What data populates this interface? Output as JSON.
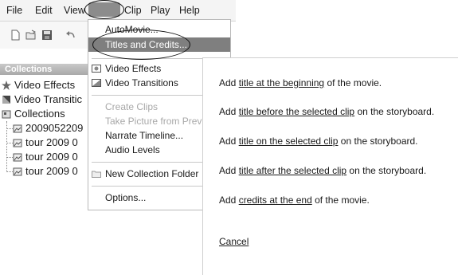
{
  "menubar": {
    "file": "File",
    "edit": "Edit",
    "view": "View",
    "clip": "Clip",
    "play": "Play",
    "help": "Help"
  },
  "sidebar": {
    "header": "Collections",
    "items": [
      {
        "label": "Video Effects",
        "icon": "star-icon"
      },
      {
        "label": "Video Transitic",
        "icon": "transition-icon"
      },
      {
        "label": "Collections",
        "icon": "collections-icon"
      },
      {
        "label": "2009052209",
        "icon": "collection-folder-icon"
      },
      {
        "label": "tour 2009 0",
        "icon": "collection-folder-icon"
      },
      {
        "label": "tour 2009 0",
        "icon": "collection-folder-icon"
      },
      {
        "label": "tour 2009 0",
        "icon": "collection-folder-icon"
      }
    ]
  },
  "tools_menu": {
    "automovie": "AutoMovie...",
    "titles_credits": "Titles and Credits...",
    "video_effects": "Video Effects",
    "video_transitions": "Video Transitions",
    "create_clips": "Create Clips",
    "take_picture": "Take Picture from Previ",
    "narrate": "Narrate Timeline...",
    "audio_levels": "Audio Levels",
    "new_collection_folder": "New Collection Folder",
    "options": "Options..."
  },
  "task_pane": {
    "lines": [
      {
        "pre": "Add ",
        "link": "title at the beginning",
        "post": " of the movie."
      },
      {
        "pre": "Add ",
        "link": "title before the selected clip",
        "post": " on the storyboard."
      },
      {
        "pre": "Add ",
        "link": "title on the selected clip",
        "post": " on the storyboard."
      },
      {
        "pre": "Add ",
        "link": "title after the selected clip",
        "post": " on the storyboard."
      },
      {
        "pre": "Add ",
        "link": "credits at the end",
        "post": " of the movie."
      }
    ],
    "cancel": "Cancel"
  },
  "colors": {
    "highlight": "#7f7f7f",
    "disabled_text": "#a8a8a8",
    "header_bar": "#b0b0b0"
  }
}
